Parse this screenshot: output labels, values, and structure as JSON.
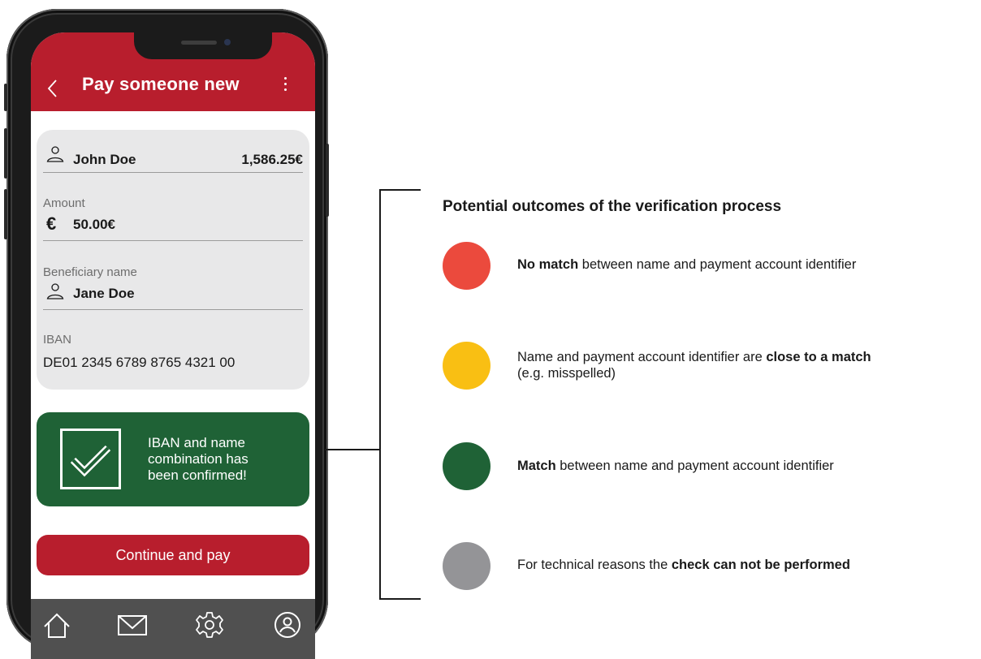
{
  "app": {
    "title": "Pay someone new",
    "account": {
      "name": "John Doe",
      "balance": "1,586.25€"
    },
    "amount": {
      "label": "Amount",
      "currency_symbol": "€",
      "value": "50.00€"
    },
    "beneficiary": {
      "label": "Beneficiary name",
      "value": "Jane Doe"
    },
    "iban": {
      "label": "IBAN",
      "value": "DE01 2345 6789 8765 4321 00"
    },
    "confirmation": {
      "line1": "IBAN and name",
      "line2": "combination has",
      "line3": "been confirmed!"
    },
    "continue_label": "Continue and pay",
    "bottom_nav": [
      "home-icon",
      "mail-icon",
      "settings-gear-icon",
      "profile-icon"
    ]
  },
  "legend": {
    "title": "Potential outcomes of the verification process",
    "outcomes": [
      {
        "color": "#eb4a3d",
        "bold_before": "No match",
        "text_after": " between name and payment account identifier"
      },
      {
        "color": "#f9bf13",
        "text_before": "Name and payment account identifier are ",
        "bold": "close to a match",
        "text_line2": "(e.g. misspelled)"
      },
      {
        "color": "#1f6236",
        "bold_before": "Match",
        "text_after": " between name and payment account identifier"
      },
      {
        "color": "#949497",
        "text_before": "For technical reasons the ",
        "bold": "check can not be performed"
      }
    ]
  },
  "colors": {
    "brand_red": "#b81e2d",
    "confirm_green": "#1f6236",
    "card_grey": "#e8e8e9",
    "nav_grey": "#505050"
  }
}
